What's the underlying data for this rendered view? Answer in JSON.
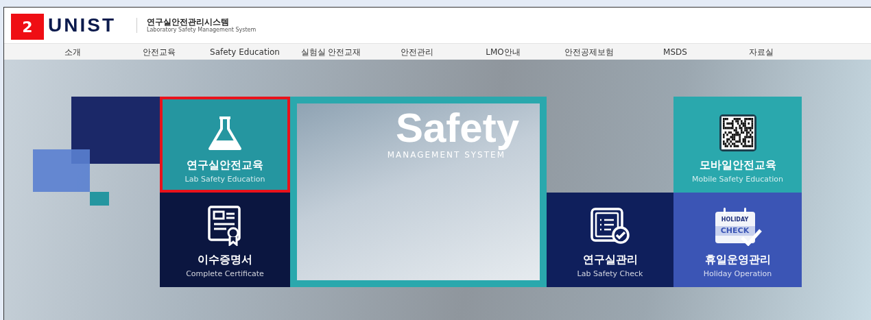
{
  "badge": "2",
  "logo": {
    "mark": "UNIST",
    "title": "연구실안전관리시스템",
    "subtitle": "Laboratory Safety Management System"
  },
  "nav": [
    "소개",
    "안전교육",
    "Safety Education",
    "실험실 안전교재",
    "안전관리",
    "LMO안내",
    "안전공제보험",
    "MSDS",
    "자료실"
  ],
  "hero": {
    "title": "Safety",
    "subtitle": "MANAGEMENT SYSTEM"
  },
  "tiles": [
    {
      "kind": "flask",
      "title": "연구실안전교육",
      "subtitle": "Lab Safety Education",
      "color": "#2596a0",
      "highlighted": true
    },
    {
      "kind": "certificate",
      "title": "이수증명서",
      "subtitle": "Complete Certificate",
      "color": "#0b1640",
      "highlighted": false
    },
    {
      "kind": "qr",
      "title": "모바일안전교육",
      "subtitle": "Mobile Safety Education",
      "color": "#2aa8ad",
      "highlighted": false
    },
    {
      "kind": "clipboard",
      "title": "연구실관리",
      "subtitle": "Lab Safety Check",
      "color": "#0f1f5c",
      "highlighted": false
    },
    {
      "kind": "calendar",
      "title": "휴일운영관리",
      "subtitle": "Holiday Operation",
      "color": "#3b55b5",
      "highlighted": false,
      "icon_text": [
        "HOLIDAY",
        "CHECK"
      ]
    }
  ]
}
